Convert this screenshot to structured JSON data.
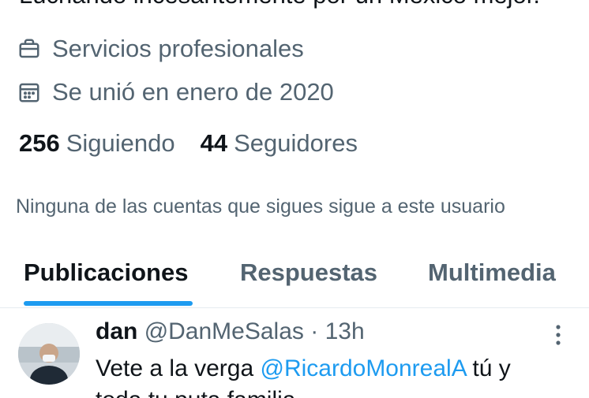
{
  "profile": {
    "bio": "Luchando incesantemente por un México mejor.",
    "category": "Servicios profesionales",
    "joined": "Se unió en enero de 2020",
    "following_count": "256",
    "following_label": "Siguiendo",
    "followers_count": "44",
    "followers_label": "Seguidores",
    "no_mutual_note": "Ninguna de las cuentas que sigues sigue a este usuario"
  },
  "tabs": [
    {
      "label": "Publicaciones",
      "active": true
    },
    {
      "label": "Respuestas",
      "active": false
    },
    {
      "label": "Multimedia",
      "active": false
    }
  ],
  "post": {
    "name": "dan",
    "handle": "@DanMeSalas",
    "separator": "·",
    "time": "13h",
    "text_before": "Vete a la verga ",
    "mention": "@RicardoMonrealA",
    "text_after": " tú y",
    "text_line2": "toda tu puta familia"
  },
  "icons": {
    "category": "briefcase-icon",
    "joined": "calendar-icon",
    "post_menu": "more-options-icon"
  },
  "colors": {
    "accent": "#1d9bf0",
    "text_primary": "#0f1419",
    "text_secondary": "#536471"
  }
}
